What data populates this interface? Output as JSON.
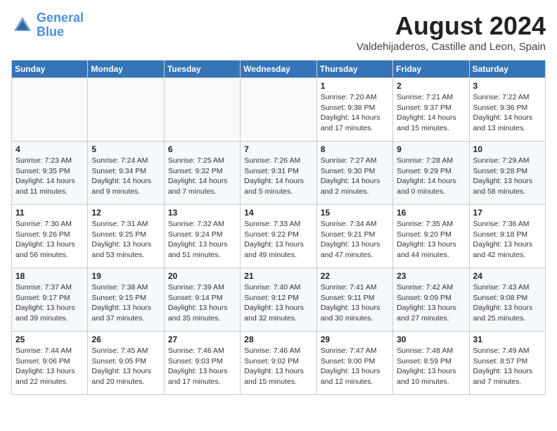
{
  "header": {
    "logo_line1": "General",
    "logo_line2": "Blue",
    "month_year": "August 2024",
    "location": "Valdehijaderos, Castille and Leon, Spain"
  },
  "weekdays": [
    "Sunday",
    "Monday",
    "Tuesday",
    "Wednesday",
    "Thursday",
    "Friday",
    "Saturday"
  ],
  "weeks": [
    [
      {
        "day": "",
        "info": ""
      },
      {
        "day": "",
        "info": ""
      },
      {
        "day": "",
        "info": ""
      },
      {
        "day": "",
        "info": ""
      },
      {
        "day": "1",
        "info": "Sunrise: 7:20 AM\nSunset: 9:38 PM\nDaylight: 14 hours\nand 17 minutes."
      },
      {
        "day": "2",
        "info": "Sunrise: 7:21 AM\nSunset: 9:37 PM\nDaylight: 14 hours\nand 15 minutes."
      },
      {
        "day": "3",
        "info": "Sunrise: 7:22 AM\nSunset: 9:36 PM\nDaylight: 14 hours\nand 13 minutes."
      }
    ],
    [
      {
        "day": "4",
        "info": "Sunrise: 7:23 AM\nSunset: 9:35 PM\nDaylight: 14 hours\nand 11 minutes."
      },
      {
        "day": "5",
        "info": "Sunrise: 7:24 AM\nSunset: 9:34 PM\nDaylight: 14 hours\nand 9 minutes."
      },
      {
        "day": "6",
        "info": "Sunrise: 7:25 AM\nSunset: 9:32 PM\nDaylight: 14 hours\nand 7 minutes."
      },
      {
        "day": "7",
        "info": "Sunrise: 7:26 AM\nSunset: 9:31 PM\nDaylight: 14 hours\nand 5 minutes."
      },
      {
        "day": "8",
        "info": "Sunrise: 7:27 AM\nSunset: 9:30 PM\nDaylight: 14 hours\nand 2 minutes."
      },
      {
        "day": "9",
        "info": "Sunrise: 7:28 AM\nSunset: 9:29 PM\nDaylight: 14 hours\nand 0 minutes."
      },
      {
        "day": "10",
        "info": "Sunrise: 7:29 AM\nSunset: 9:28 PM\nDaylight: 13 hours\nand 58 minutes."
      }
    ],
    [
      {
        "day": "11",
        "info": "Sunrise: 7:30 AM\nSunset: 9:26 PM\nDaylight: 13 hours\nand 56 minutes."
      },
      {
        "day": "12",
        "info": "Sunrise: 7:31 AM\nSunset: 9:25 PM\nDaylight: 13 hours\nand 53 minutes."
      },
      {
        "day": "13",
        "info": "Sunrise: 7:32 AM\nSunset: 9:24 PM\nDaylight: 13 hours\nand 51 minutes."
      },
      {
        "day": "14",
        "info": "Sunrise: 7:33 AM\nSunset: 9:22 PM\nDaylight: 13 hours\nand 49 minutes."
      },
      {
        "day": "15",
        "info": "Sunrise: 7:34 AM\nSunset: 9:21 PM\nDaylight: 13 hours\nand 47 minutes."
      },
      {
        "day": "16",
        "info": "Sunrise: 7:35 AM\nSunset: 9:20 PM\nDaylight: 13 hours\nand 44 minutes."
      },
      {
        "day": "17",
        "info": "Sunrise: 7:36 AM\nSunset: 9:18 PM\nDaylight: 13 hours\nand 42 minutes."
      }
    ],
    [
      {
        "day": "18",
        "info": "Sunrise: 7:37 AM\nSunset: 9:17 PM\nDaylight: 13 hours\nand 39 minutes."
      },
      {
        "day": "19",
        "info": "Sunrise: 7:38 AM\nSunset: 9:15 PM\nDaylight: 13 hours\nand 37 minutes."
      },
      {
        "day": "20",
        "info": "Sunrise: 7:39 AM\nSunset: 9:14 PM\nDaylight: 13 hours\nand 35 minutes."
      },
      {
        "day": "21",
        "info": "Sunrise: 7:40 AM\nSunset: 9:12 PM\nDaylight: 13 hours\nand 32 minutes."
      },
      {
        "day": "22",
        "info": "Sunrise: 7:41 AM\nSunset: 9:11 PM\nDaylight: 13 hours\nand 30 minutes."
      },
      {
        "day": "23",
        "info": "Sunrise: 7:42 AM\nSunset: 9:09 PM\nDaylight: 13 hours\nand 27 minutes."
      },
      {
        "day": "24",
        "info": "Sunrise: 7:43 AM\nSunset: 9:08 PM\nDaylight: 13 hours\nand 25 minutes."
      }
    ],
    [
      {
        "day": "25",
        "info": "Sunrise: 7:44 AM\nSunset: 9:06 PM\nDaylight: 13 hours\nand 22 minutes."
      },
      {
        "day": "26",
        "info": "Sunrise: 7:45 AM\nSunset: 9:05 PM\nDaylight: 13 hours\nand 20 minutes."
      },
      {
        "day": "27",
        "info": "Sunrise: 7:46 AM\nSunset: 9:03 PM\nDaylight: 13 hours\nand 17 minutes."
      },
      {
        "day": "28",
        "info": "Sunrise: 7:46 AM\nSunset: 9:02 PM\nDaylight: 13 hours\nand 15 minutes."
      },
      {
        "day": "29",
        "info": "Sunrise: 7:47 AM\nSunset: 9:00 PM\nDaylight: 13 hours\nand 12 minutes."
      },
      {
        "day": "30",
        "info": "Sunrise: 7:48 AM\nSunset: 8:59 PM\nDaylight: 13 hours\nand 10 minutes."
      },
      {
        "day": "31",
        "info": "Sunrise: 7:49 AM\nSunset: 8:57 PM\nDaylight: 13 hours\nand 7 minutes."
      }
    ]
  ]
}
